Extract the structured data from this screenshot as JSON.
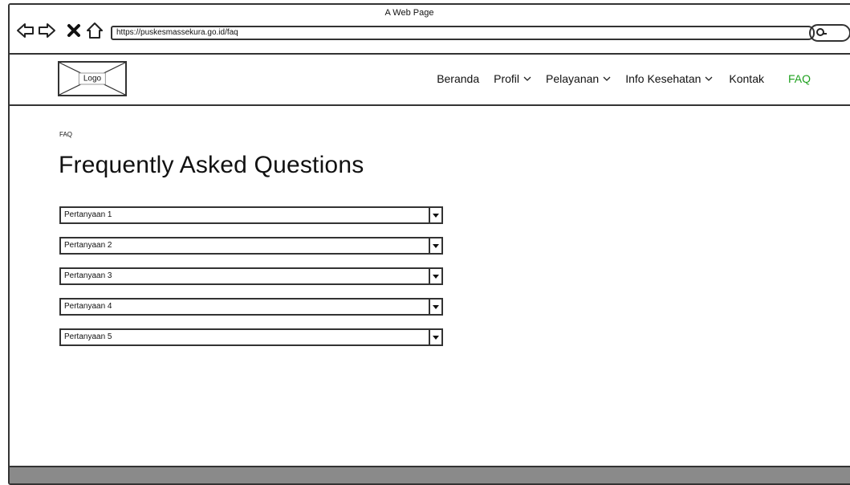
{
  "window": {
    "title": "A Web Page",
    "url": "https://puskesmassekura.go.id/faq"
  },
  "header": {
    "logo_label": "Logo",
    "menu": [
      {
        "label": "Beranda",
        "has_dropdown": false
      },
      {
        "label": "Profil",
        "has_dropdown": true
      },
      {
        "label": "Pelayanan",
        "has_dropdown": true
      },
      {
        "label": "Info Kesehatan",
        "has_dropdown": true
      },
      {
        "label": "Kontak",
        "has_dropdown": false
      },
      {
        "label": "FAQ",
        "has_dropdown": false,
        "active": true
      }
    ]
  },
  "main": {
    "breadcrumb": "FAQ",
    "title": "Frequently Asked Questions",
    "faq": [
      {
        "question": "Pertanyaan 1"
      },
      {
        "question": "Pertanyaan 2"
      },
      {
        "question": "Pertanyaan 3"
      },
      {
        "question": "Pertanyaan 4"
      },
      {
        "question": "Pertanyaan 5"
      }
    ]
  },
  "colors": {
    "active_menu": "#1fa11f",
    "status_bar": "#8a8a8a"
  },
  "icons": {
    "back": "back-arrow-icon",
    "forward": "forward-arrow-icon",
    "stop": "close-x-icon",
    "home": "home-icon",
    "search": "search-icon",
    "dropdown": "chevron-down-icon"
  }
}
